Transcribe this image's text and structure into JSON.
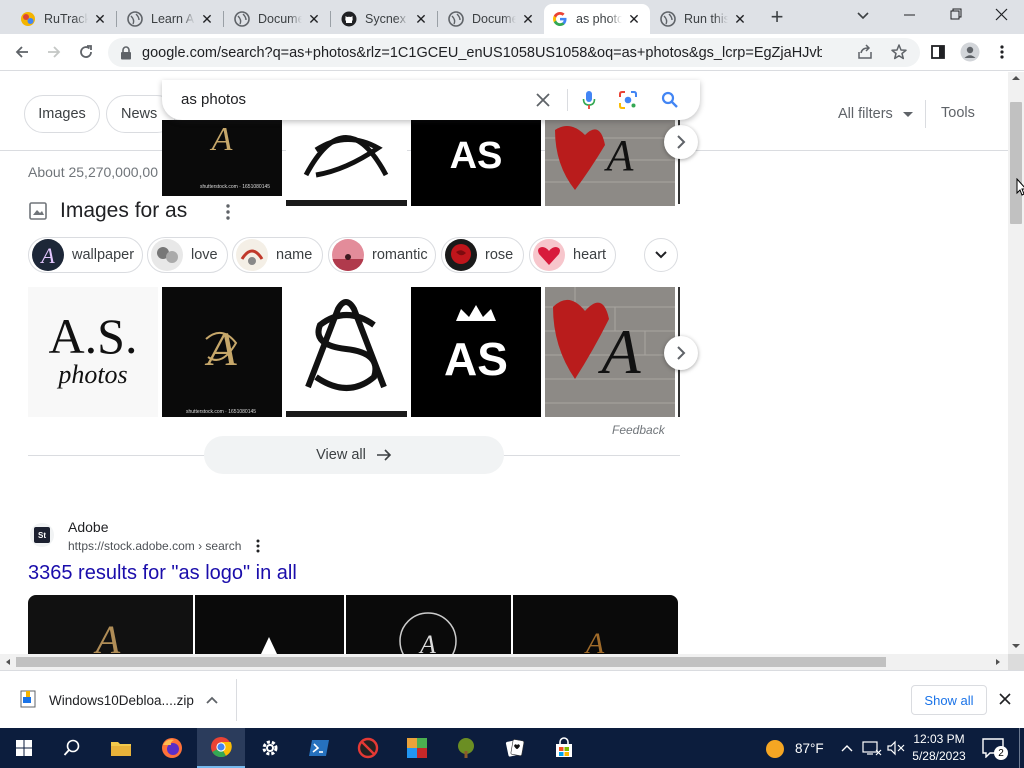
{
  "tabs": [
    {
      "label": "RuTracker",
      "active": false
    },
    {
      "label": "Learn About",
      "active": false
    },
    {
      "label": "Document",
      "active": false
    },
    {
      "label": "Sycnex",
      "active": false
    },
    {
      "label": "Document",
      "active": false
    },
    {
      "label": "as photos",
      "active": true
    },
    {
      "label": "Run this",
      "active": false
    }
  ],
  "address_bar": {
    "url": "google.com/search?q=as+photos&rlz=1C1GCEU_enUS1058US1058&oq=as+photos&gs_lcrp=EgZjaHJvbWUyBg..."
  },
  "search": {
    "query": "as photos"
  },
  "filters": {
    "chips": [
      "Images",
      "News"
    ],
    "all_filters": "All filters",
    "tools": "Tools"
  },
  "results": {
    "about": "About 25,270,000,00",
    "images_heading": "Images for as",
    "suggestions": [
      "wallpaper",
      "love",
      "name",
      "romantic",
      "rose",
      "heart"
    ],
    "thumb_logo_text_top": "A.S.",
    "thumb_logo_text_bottom": "photos",
    "thumb_monogram": "AS",
    "thumb_shutterstock": "shutterstock.com · 1651080145",
    "feedback": "Feedback",
    "view_all": "View all",
    "site_name": "Adobe",
    "site_url": "https://stock.adobe.com › search",
    "site_favicon": "St",
    "result_title": "3365 results for \"as logo\" in all"
  },
  "download": {
    "filename": "Windows10Debloa....zip",
    "show_all": "Show all"
  },
  "taskbar": {
    "weather": "87°F",
    "time": "12:03 PM",
    "date": "5/28/2023",
    "notifications": "2"
  },
  "colors": {
    "link": "#1a0dab",
    "tab_bg": "#dee1e6",
    "taskbar": "#0c1d3d",
    "google_blue": "#4285f4",
    "chrome_red": "#ea4335"
  }
}
